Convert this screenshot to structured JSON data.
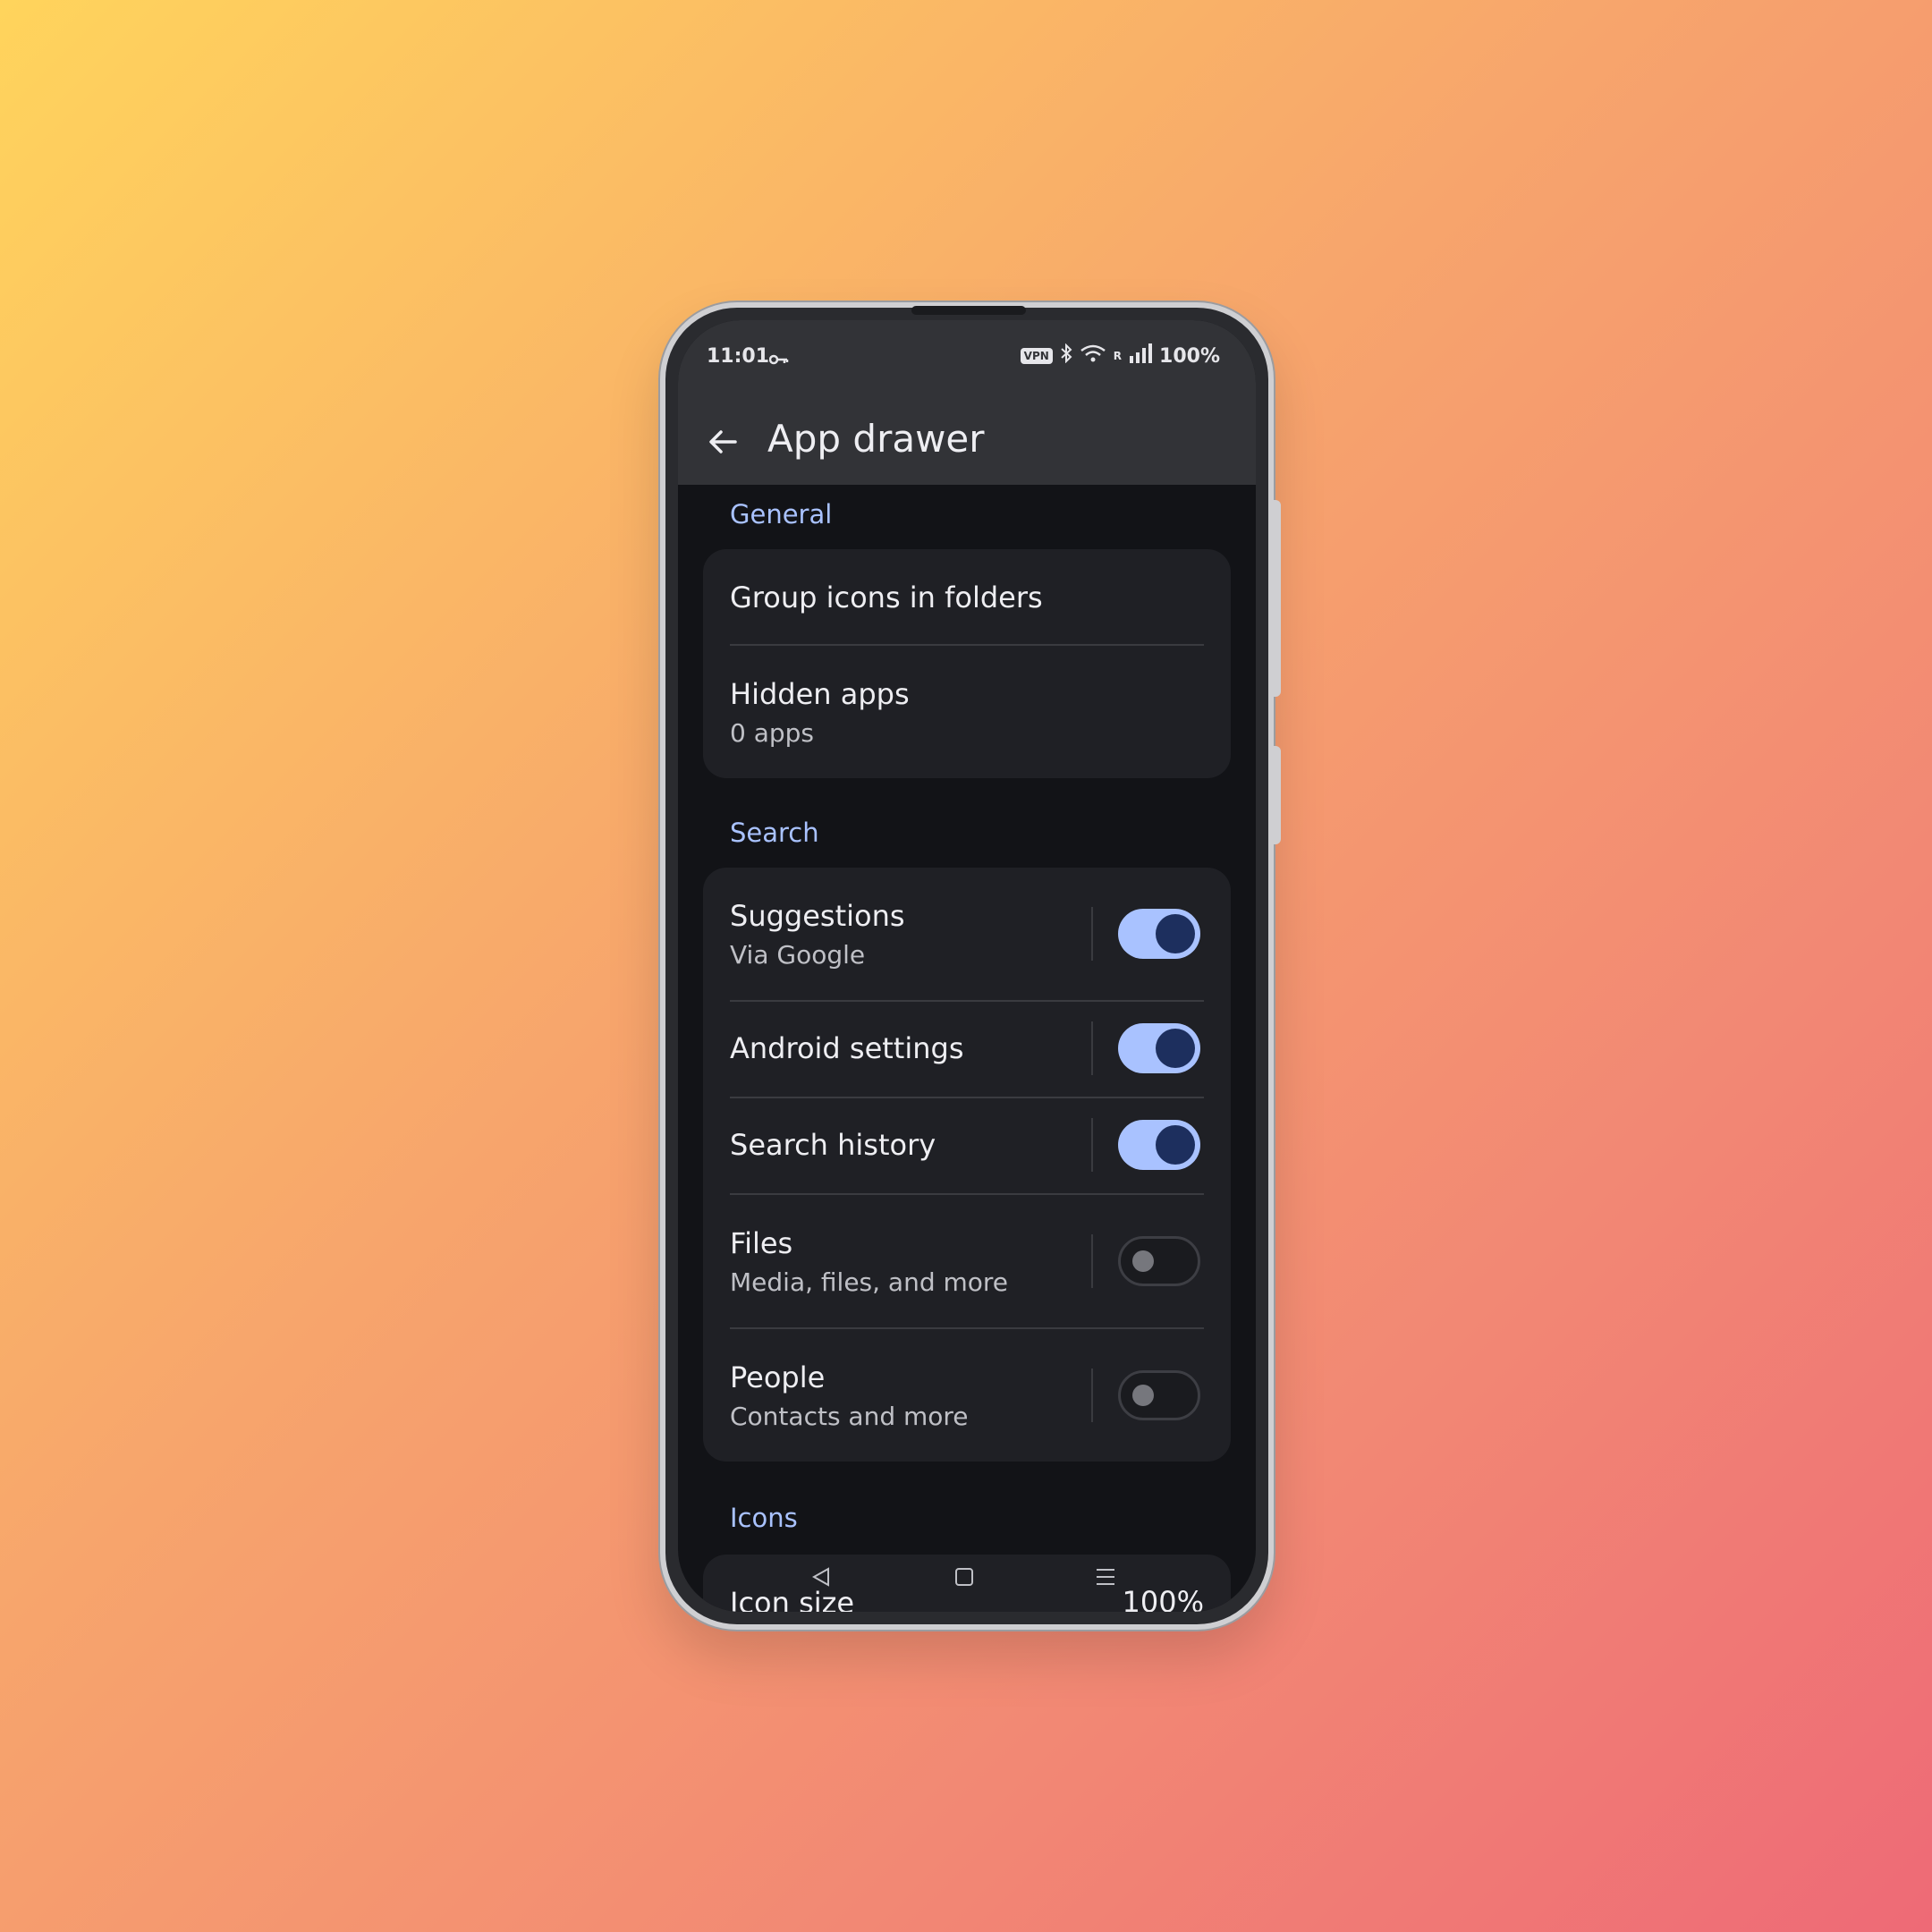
{
  "status_bar": {
    "time": "11:01",
    "vpn": "VPN",
    "roaming": "R",
    "battery": "100%"
  },
  "header": {
    "title": "App drawer"
  },
  "sections": {
    "general": {
      "title": "General",
      "group_icons": {
        "title": "Group icons in folders"
      },
      "hidden_apps": {
        "title": "Hidden apps",
        "subtitle": "0 apps"
      }
    },
    "search": {
      "title": "Search",
      "suggestions": {
        "title": "Suggestions",
        "subtitle": "Via Google",
        "enabled": true
      },
      "android_settings": {
        "title": "Android settings",
        "enabled": true
      },
      "search_history": {
        "title": "Search history",
        "enabled": true
      },
      "files": {
        "title": "Files",
        "subtitle": "Media, files, and more",
        "enabled": false
      },
      "people": {
        "title": "People",
        "subtitle": "Contacts and more",
        "enabled": false
      }
    },
    "icons": {
      "title": "Icons",
      "icon_size": {
        "title": "Icon size",
        "value": "100%"
      }
    }
  },
  "colors": {
    "accent": "#a9c2ff",
    "surface": "#1f2025",
    "background": "#121317",
    "appbar": "#323337"
  }
}
